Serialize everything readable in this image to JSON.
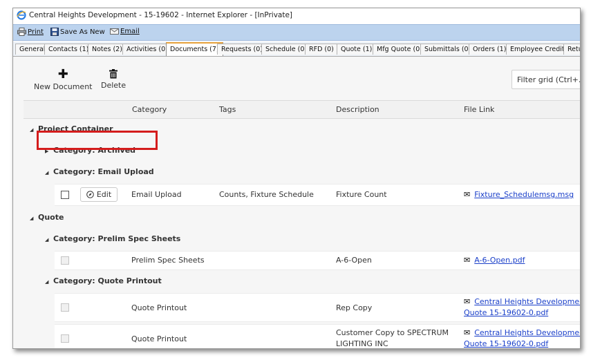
{
  "window": {
    "title": "Central Heights Development - 15-19602 - Internet Explorer - [InPrivate]"
  },
  "toolbar": {
    "print": "Print",
    "save_as_new": "Save As New",
    "email": "Email"
  },
  "tabs": [
    "General",
    "Contacts (1)",
    "Notes (2)",
    "Activities (0)",
    "Documents (7)",
    "Requests (0)",
    "Schedule (0)",
    "RFD (0)",
    "Quote (1)",
    "Mfg Quote (0)",
    "Submittals (0)",
    "Orders (1)",
    "Employee Credits",
    "Retu"
  ],
  "actions": {
    "new_document": "New Document",
    "delete": "Delete"
  },
  "filter": {
    "placeholder": "Filter grid (Ctrl+.)"
  },
  "columns": {
    "category": "Category",
    "tags": "Tags",
    "description": "Description",
    "file_link": "File Link"
  },
  "groups": {
    "project_container": "Project Container",
    "archived": "Category: Archived",
    "email_upload": "Category: Email Upload",
    "quote": "Quote",
    "prelim_spec": "Category: Prelim Spec Sheets",
    "quote_printout": "Category: Quote Printout"
  },
  "rows": [
    {
      "category": "Email Upload",
      "tags": "Counts, Fixture Schedule",
      "description": "Fixture Count",
      "file": "Fixture_Schedulemsg.msg",
      "edit": "Edit"
    },
    {
      "category": "Prelim Spec Sheets",
      "tags": "",
      "description": "A-6-Open",
      "file": "A-6-Open.pdf"
    },
    {
      "category": "Quote Printout",
      "tags": "",
      "description": "Rep Copy",
      "file_line1": "Central Heights Development",
      "file_line2": "Quote 15-19602-0.pdf"
    },
    {
      "category": "Quote Printout",
      "tags": "",
      "description_line1": "Customer Copy to SPECTRUM",
      "description_line2": "LIGHTING INC",
      "file_line1": "Central Heights Development",
      "file_line2": "Quote 15-19602-0.pdf"
    }
  ],
  "colors": {
    "highlight": "#d41c1c",
    "link": "#1a3fc9",
    "toolbar": "#bcd3ee",
    "active_tab_accent": "#e8a33c"
  }
}
